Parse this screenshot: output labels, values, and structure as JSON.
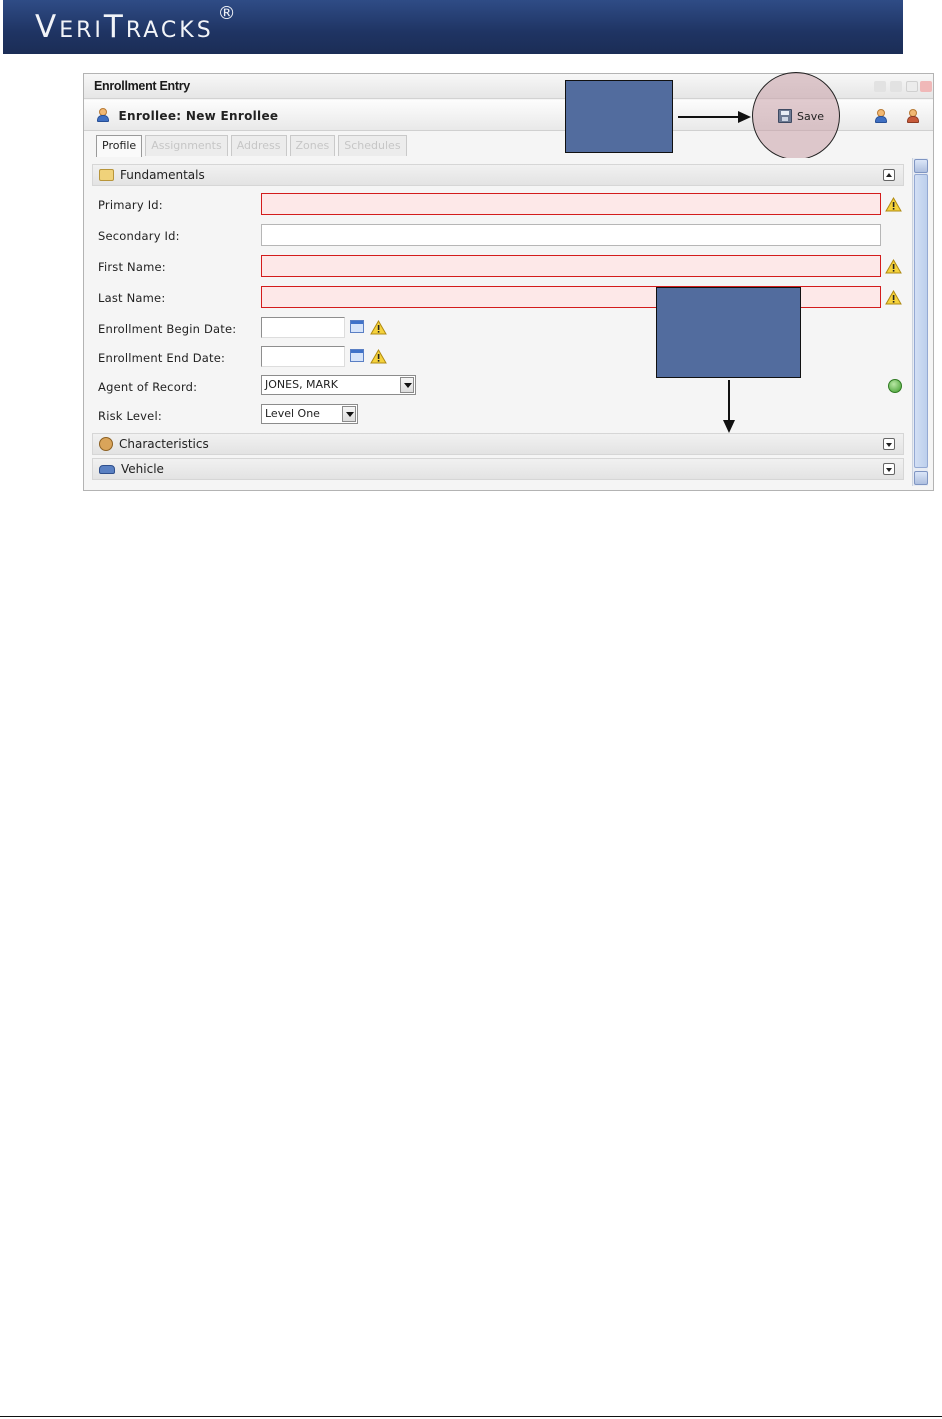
{
  "banner": {
    "brand_first": "V",
    "brand_rest": "ERI",
    "brand_second": "T",
    "brand_rest2": "RACKS",
    "trademark": "®"
  },
  "window": {
    "title": "Enrollment Entry",
    "enrollee_label": "Enrollee:",
    "enrollee_value": "New Enrollee",
    "save_label": "Save"
  },
  "tabs": [
    {
      "label": "Profile",
      "active": true
    },
    {
      "label": "Assignments",
      "active": false
    },
    {
      "label": "Address",
      "active": false
    },
    {
      "label": "Zones",
      "active": false
    },
    {
      "label": "Schedules",
      "active": false
    }
  ],
  "sections": {
    "fundamentals": "Fundamentals",
    "characteristics": "Characteristics",
    "vehicle": "Vehicle"
  },
  "fields": {
    "primary_id": {
      "label": "Primary Id:",
      "value": ""
    },
    "secondary_id": {
      "label": "Secondary Id:",
      "value": ""
    },
    "first_name": {
      "label": "First Name:",
      "value": ""
    },
    "last_name": {
      "label": "Last Name:",
      "value": ""
    },
    "begin_date": {
      "label": "Enrollment Begin Date:",
      "value": ""
    },
    "end_date": {
      "label": "Enrollment End Date:",
      "value": ""
    },
    "agent": {
      "label": "Agent of Record:",
      "value": "JONES, MARK"
    },
    "risk": {
      "label": "Risk Level:",
      "value": "Level One"
    }
  },
  "colors": {
    "banner": "#1f3463",
    "required_border": "#d31c1c",
    "required_fill": "#fde8e8",
    "callout": "#526c9e",
    "save_highlight": "#c9a0a8"
  },
  "icons": [
    "person-icon",
    "floppy-icon",
    "warning-icon",
    "calendar-icon",
    "check-icon",
    "car-icon",
    "folder-icon"
  ]
}
